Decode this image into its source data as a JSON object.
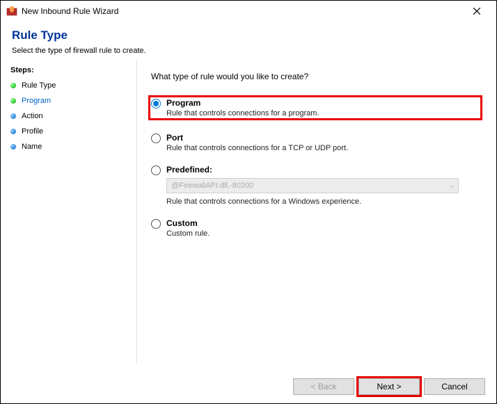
{
  "window": {
    "title": "New Inbound Rule Wizard"
  },
  "header": {
    "title": "Rule Type",
    "description": "Select the type of firewall rule to create."
  },
  "sidebar": {
    "title": "Steps:",
    "items": [
      {
        "label": "Rule Type",
        "bullet": "green",
        "active": false
      },
      {
        "label": "Program",
        "bullet": "green",
        "active": true
      },
      {
        "label": "Action",
        "bullet": "blue",
        "active": false
      },
      {
        "label": "Profile",
        "bullet": "blue",
        "active": false
      },
      {
        "label": "Name",
        "bullet": "blue",
        "active": false
      }
    ]
  },
  "main": {
    "question": "What type of rule would you like to create?",
    "options": {
      "program": {
        "title": "Program",
        "desc": "Rule that controls connections for a program."
      },
      "port": {
        "title": "Port",
        "desc": "Rule that controls connections for a TCP or UDP port."
      },
      "predefined": {
        "title": "Predefined:",
        "select_value": "@FirewallAPI.dll,-80200",
        "desc": "Rule that controls connections for a Windows experience."
      },
      "custom": {
        "title": "Custom",
        "desc": "Custom rule."
      }
    }
  },
  "footer": {
    "back": "< Back",
    "next": "Next >",
    "cancel": "Cancel"
  }
}
